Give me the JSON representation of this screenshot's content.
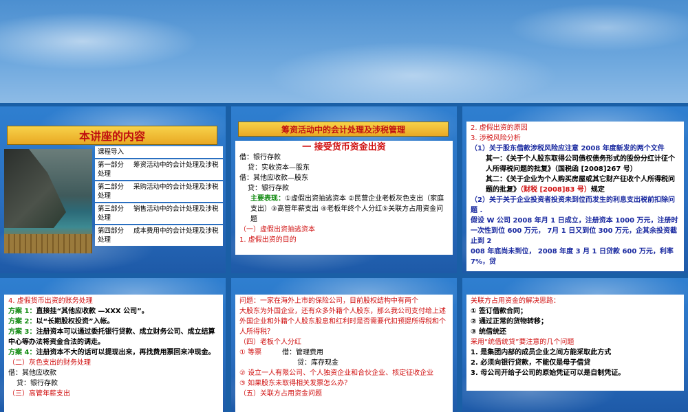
{
  "slide1": {
    "title": "本讲座的内容",
    "agenda": [
      {
        "part": "",
        "text": "课程导入"
      },
      {
        "part": "第一部分",
        "text": "筹资活动中的会计处理及涉税处理"
      },
      {
        "part": "第二部分",
        "text": "采购活动中的会计处理及涉税处理"
      },
      {
        "part": "第三部分",
        "text": "销售活动中的会计处理及涉税处理"
      },
      {
        "part": "第四部分",
        "text": "成本费用中的会计处理及涉税处理"
      }
    ]
  },
  "slide2": {
    "title": "筹资活动中的会计处理及涉税管理",
    "heading": "一 接受货币资金出资",
    "lines": [
      "借：银行存款",
      "贷：实收资本—股东",
      "借：其他应收款—股东",
      "贷：银行存款",
      "主要表现：",
      "①虚假出资抽逃资本 ②民营企业老板灰色支出（家庭支出）③高管年薪支出 ④老板年终个人分红⑤关联方占用资金问题",
      "（一）虚假出资抽逃资本",
      "1. 虚假出资的目的"
    ]
  },
  "slide3": {
    "lines": [
      "2. 虚假出资的原因",
      "3. 涉税风险分析",
      "（1）关于股东借款涉税风险应注意 2008 年度新发的两个文件",
      "其一：《关于个人股东取得公司债权债务形式的股份分红计征个人所得税问题的批复》（国税函 [2008]267 号）",
      "其二：《关于企业为个人购买房屋或其它财产征收个人所得税问题的批复》",
      "（财税 [2008]83 号）",
      "规定",
      "（2）关于关于企业投资者投资未到位而发生的利息支出税前扣除问题 .",
      "假设 W 公司 2008 年月 1 日成立，注册资本 1000 万元，注册时一次性到位 600 万元， 7月 1 日又到位 300 万元，企其余投资截止到 2",
      "008 年底尚未到位， 2008 年度 3 月 1 日贷款 600 万元，利率 7%，贷"
    ]
  },
  "slide4": {
    "lines": [
      "4. 虚假货币出资的账务处理",
      "方案 1：",
      "直接挂“其他应收款 —XXX 公司”。",
      "方案 2：",
      "以“长期股权投资”入帐。",
      "方案 3：",
      "注册资本可以通过委托银行贷款、成立财务公司、成立结算中心等办法将资金合法的调走。",
      "方案 4：",
      "注册资本不大的话可以提现出来，再找费用票回来冲现金。",
      "（二）灰色支出的财务处理",
      "借：其他应收款",
      "贷：银行存款",
      "（三）高管年薪支出"
    ]
  },
  "slide5": {
    "lines": [
      "问题：一家在海外上市的保险公司，目前股权结构中有两个",
      "大股东为外国企业，还有众多外籍个人股东，那么我公司支付给上述外国企业和外籍个人股东股息和红利时是否需要代扣预提所得税和个人所得税？",
      "（四）老板个人分红",
      "① 等票",
      "借：管理费用",
      "贷：库存现金",
      "② 设立一人有限公司、个人独资企业和合伙企业、核定征收企业",
      "③ 如果股东未取得相关发票怎么办？",
      "（五）关联方占用资金问题"
    ]
  },
  "slide6": {
    "lines": [
      "关联方占用资金的解决思路：",
      "① 签订借款合同；",
      "② 通过正常的货物转移；",
      "③ 统借统还",
      "采用“统借统贷”要注意的几个问题",
      "1. 是集团内部的成员企业之间方能采取此方式",
      "2. 必须向银行贷款，不能仅是母子借贷",
      "3. 母公司开给子公司的原始凭证可以是自制凭证。"
    ]
  }
}
